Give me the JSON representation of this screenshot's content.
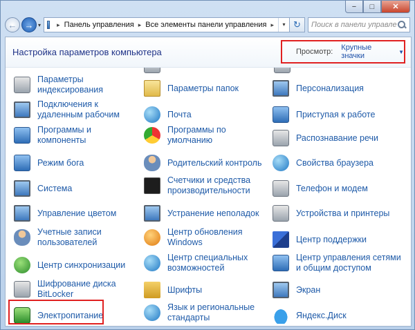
{
  "window": {
    "controls": {
      "minimize": "−",
      "maximize": "□",
      "close": "✕"
    }
  },
  "address_bar": {
    "history_glyph": "▾",
    "crumbs": [
      "Панель управления",
      "Все элементы панели управления"
    ],
    "crumb_separator": "▸",
    "dropdown_glyph": "▾",
    "refresh_glyph": "↻"
  },
  "search": {
    "placeholder": "Поиск в панели управления"
  },
  "header": {
    "title": "Настройка параметров компьютера",
    "view_label": "Просмотр:",
    "view_value": "Крупные значки",
    "view_caret": "▼"
  },
  "columns": [
    {
      "items": [
        {
          "label": "Параметры\nиндексирования",
          "icon": "indexing-icon"
        },
        {
          "label": "Подключения к\nудаленным рабочим",
          "icon": "remote-desktop-icon"
        },
        {
          "label": "Программы и\nкомпоненты",
          "icon": "programs-icon"
        },
        {
          "label": "Режим бога",
          "icon": "god-mode-icon"
        },
        {
          "label": "Система",
          "icon": "system-icon"
        },
        {
          "label": "Управление цветом",
          "icon": "color-management-icon"
        },
        {
          "label": "Учетные записи\nпользователей",
          "icon": "user-accounts-icon"
        },
        {
          "label": "Центр синхронизации",
          "icon": "sync-center-icon"
        },
        {
          "label": "Шифрование диска\nBitLocker",
          "icon": "bitlocker-icon"
        },
        {
          "label": "Электропитание",
          "icon": "power-options-icon"
        }
      ]
    },
    {
      "items": [
        {
          "label": "Параметры папок",
          "icon": "folder-options-icon"
        },
        {
          "label": "Почта",
          "icon": "mail-icon"
        },
        {
          "label": "Программы по\nумолчанию",
          "icon": "default-programs-icon"
        },
        {
          "label": "Родительский контроль",
          "icon": "parental-controls-icon"
        },
        {
          "label": "Счетчики и средства\nпроизводительности",
          "icon": "performance-icon"
        },
        {
          "label": "Устранение неполадок",
          "icon": "troubleshooting-icon"
        },
        {
          "label": "Центр обновления\nWindows",
          "icon": "windows-update-icon"
        },
        {
          "label": "Центр специальных\nвозможностей",
          "icon": "accessibility-icon"
        },
        {
          "label": "Шрифты",
          "icon": "fonts-icon"
        },
        {
          "label": "Язык и региональные\nстандарты",
          "icon": "region-language-icon"
        }
      ]
    },
    {
      "items": [
        {
          "label": "Персонализация",
          "icon": "personalization-icon"
        },
        {
          "label": "Приступая к работе",
          "icon": "getting-started-icon"
        },
        {
          "label": "Распознавание речи",
          "icon": "speech-recognition-icon"
        },
        {
          "label": "Свойства браузера",
          "icon": "internet-options-icon"
        },
        {
          "label": "Телефон и модем",
          "icon": "phone-modem-icon"
        },
        {
          "label": "Устройства и принтеры",
          "icon": "devices-printers-icon"
        },
        {
          "label": "Центр поддержки",
          "icon": "action-center-icon"
        },
        {
          "label": "Центр управления сетями\nи общим доступом",
          "icon": "network-center-icon"
        },
        {
          "label": "Экран",
          "icon": "display-icon"
        },
        {
          "label": "Яндекс.Диск",
          "icon": "yandex-disk-icon"
        }
      ]
    }
  ]
}
